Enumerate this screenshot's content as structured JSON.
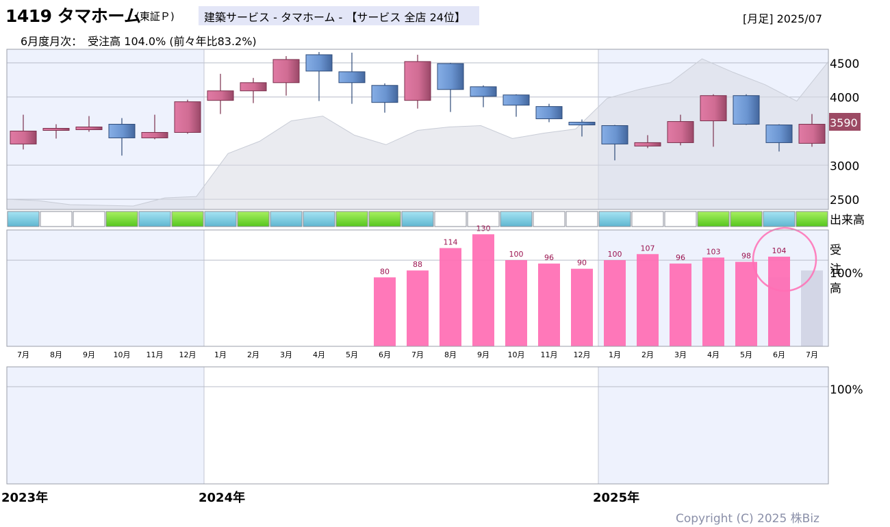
{
  "header": {
    "title": "1419 タマホーム",
    "market": "(東証Ｐ)",
    "sector": "建築サービス - タマホーム - 【サービス 全店 24位】",
    "period": "[月足] 2025/07",
    "monthly_note": "6月度月次：　受注高 104.0% (前々年比83.2%)"
  },
  "footer": {
    "copyright": "Copyright (C) 2025 株Biz"
  },
  "colors": {
    "up": "#c85c85",
    "down": "#5f88c8",
    "bar": "#ff6eb4",
    "current_price_bg": "#9c4a64"
  },
  "chart_data": {
    "type": "candlestick",
    "months": [
      "7月",
      "8月",
      "9月",
      "10月",
      "11月",
      "12月",
      "1月",
      "2月",
      "3月",
      "4月",
      "5月",
      "6月",
      "7月",
      "8月",
      "9月",
      "10月",
      "11月",
      "12月",
      "1月",
      "2月",
      "3月",
      "4月",
      "5月",
      "6月",
      "7月"
    ],
    "years": [
      {
        "label": "2023年",
        "start_index": 0
      },
      {
        "label": "2024年",
        "start_index": 6
      },
      {
        "label": "2025年",
        "start_index": 18
      }
    ],
    "price_axis": {
      "ylim": [
        2350,
        4700
      ],
      "ticks": [
        4500,
        4000,
        3000,
        2500
      ]
    },
    "current_price": "3590",
    "candles": [
      {
        "o": 3310,
        "h": 3740,
        "l": 3230,
        "c": 3500
      },
      {
        "o": 3520,
        "h": 3600,
        "l": 3390,
        "c": 3540
      },
      {
        "o": 3520,
        "h": 3720,
        "l": 3490,
        "c": 3560
      },
      {
        "o": 3600,
        "h": 3690,
        "l": 3140,
        "c": 3400
      },
      {
        "o": 3400,
        "h": 3740,
        "l": 3380,
        "c": 3480
      },
      {
        "o": 3480,
        "h": 3960,
        "l": 3460,
        "c": 3930
      },
      {
        "o": 3950,
        "h": 4340,
        "l": 3750,
        "c": 4090
      },
      {
        "o": 4090,
        "h": 4280,
        "l": 3910,
        "c": 4210
      },
      {
        "o": 4210,
        "h": 4600,
        "l": 4020,
        "c": 4550
      },
      {
        "o": 4620,
        "h": 4660,
        "l": 3940,
        "c": 4380
      },
      {
        "o": 4370,
        "h": 4650,
        "l": 3900,
        "c": 4210
      },
      {
        "o": 4170,
        "h": 4200,
        "l": 3770,
        "c": 3920
      },
      {
        "o": 3950,
        "h": 4620,
        "l": 3830,
        "c": 4520
      },
      {
        "o": 4490,
        "h": 4500,
        "l": 3780,
        "c": 4110
      },
      {
        "o": 4150,
        "h": 4170,
        "l": 3850,
        "c": 4010
      },
      {
        "o": 4030,
        "h": 4040,
        "l": 3710,
        "c": 3880
      },
      {
        "o": 3860,
        "h": 3900,
        "l": 3630,
        "c": 3680
      },
      {
        "o": 3630,
        "h": 3670,
        "l": 3420,
        "c": 3590
      },
      {
        "o": 3580,
        "h": 3590,
        "l": 3070,
        "c": 3310
      },
      {
        "o": 3280,
        "h": 3440,
        "l": 3250,
        "c": 3330
      },
      {
        "o": 3330,
        "h": 3740,
        "l": 3290,
        "c": 3640
      },
      {
        "o": 3650,
        "h": 4040,
        "l": 3270,
        "c": 4020
      },
      {
        "o": 4020,
        "h": 4040,
        "l": 3590,
        "c": 3600
      },
      {
        "o": 3590,
        "h": 3600,
        "l": 3200,
        "c": 3330
      },
      {
        "o": 3320,
        "h": 3750,
        "l": 3270,
        "c": 3600
      }
    ],
    "volume_area": [
      2500,
      2480,
      2420,
      2410,
      2400,
      2520,
      2540,
      3170,
      3350,
      3650,
      3720,
      3440,
      3300,
      3510,
      3560,
      3580,
      3390,
      3470,
      3530,
      3980,
      4110,
      4210,
      4560,
      4360,
      4180,
      3940,
      4520
    ],
    "volume_label": "出来高",
    "volume_levels": [
      "low",
      "none",
      "none",
      "high",
      "low",
      "high",
      "low",
      "high",
      "low",
      "low",
      "high",
      "high",
      "low",
      "none",
      "none",
      "low",
      "none",
      "none",
      "low",
      "none",
      "none",
      "high",
      "high",
      "low",
      "high"
    ],
    "order_panel": {
      "label": "受注高",
      "ref_label": "100%",
      "ylim": [
        0,
        135
      ],
      "ref": 100,
      "values": [
        null,
        null,
        null,
        null,
        null,
        null,
        null,
        null,
        null,
        null,
        null,
        80,
        88,
        114,
        130,
        100,
        96,
        90,
        100,
        107,
        96,
        103,
        98,
        104,
        null
      ],
      "gray_values": [
        null,
        null,
        null,
        null,
        null,
        null,
        null,
        null,
        null,
        null,
        null,
        null,
        null,
        null,
        null,
        null,
        null,
        null,
        null,
        null,
        null,
        null,
        null,
        80,
        88
      ],
      "highlight_index": 23
    },
    "bottom_panel": {
      "ref_label": "100%"
    }
  }
}
